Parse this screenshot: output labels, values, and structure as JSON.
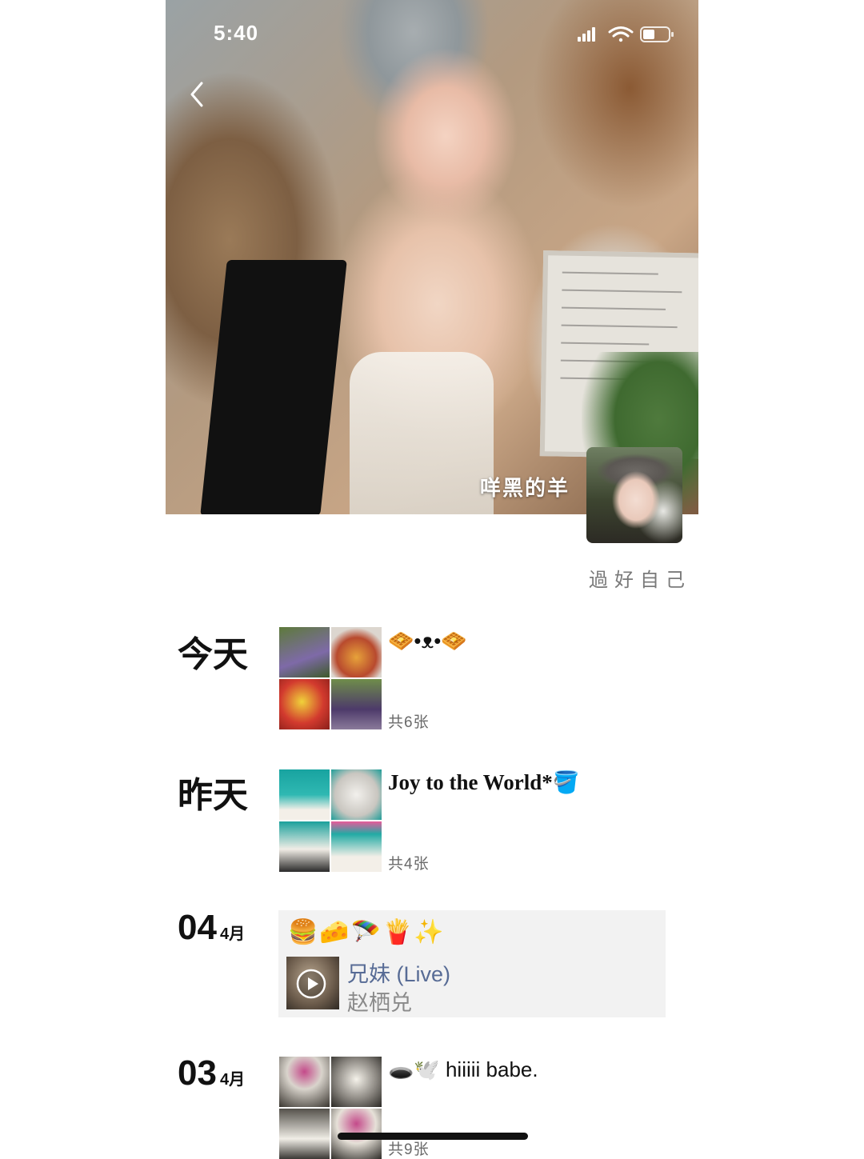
{
  "status_bar": {
    "time": "5:40"
  },
  "profile": {
    "nickname": "咩黑的羊",
    "signature": "過好自己"
  },
  "timeline": [
    {
      "date_label": "今天",
      "text": "🧇•ᴥ•🧇",
      "photo_count": "共6张"
    },
    {
      "date_label": "昨天",
      "text": "Joy to the World*🪣",
      "photo_count": "共4张"
    },
    {
      "day": "04",
      "month": "4月",
      "emojis": "🍔🧀🪂🍟✨",
      "music": {
        "title": "兄妹 (Live)",
        "artist": "赵栖兑"
      }
    },
    {
      "day": "03",
      "month": "4月",
      "text": "🕳️🕊️ hiiiii babe.",
      "photo_count": "共9张"
    }
  ],
  "colors": {
    "link_blue": "#576b95",
    "card_bg": "#f2f2f2",
    "muted_text": "#7a7a7a"
  }
}
